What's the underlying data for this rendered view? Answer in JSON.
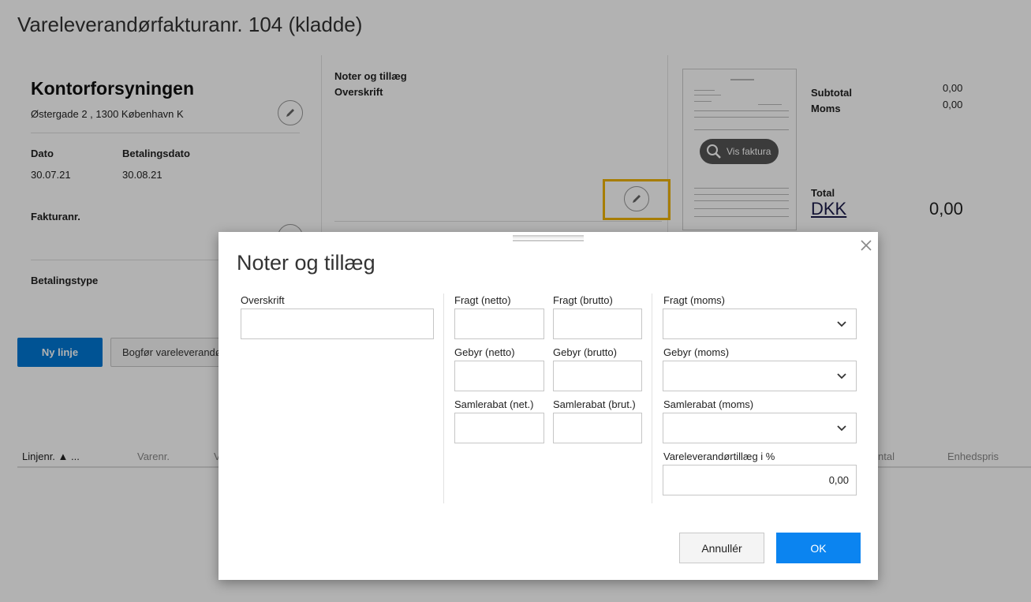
{
  "page": {
    "title": "Vareleverandørfakturanr. 104 (kladde)"
  },
  "supplier": {
    "name": "Kontorforsyningen",
    "address": "Østergade 2 , 1300 København K",
    "dato_label": "Dato",
    "dato_value": "30.07.21",
    "betalingsdato_label": "Betalingsdato",
    "betalingsdato_value": "30.08.21",
    "fakturanr_label": "Fakturanr.",
    "betalingstype_label": "Betalingstype"
  },
  "notes_panel": {
    "heading": "Noter og tillæg",
    "overskrift_label": "Overskrift"
  },
  "invoice_preview": {
    "vis_faktura_label": "Vis faktura"
  },
  "totals": {
    "subtotal_label": "Subtotal",
    "subtotal_value": "0,00",
    "moms_label": "Moms",
    "moms_value": "0,00",
    "total_label": "Total",
    "currency": "DKK",
    "total_value": "0,00"
  },
  "actions": {
    "ny_linje": "Ny linje",
    "bogfor": "Bogfør vareleverandørfaktura"
  },
  "table": {
    "columns": [
      "Linjenr. ▲ ...",
      "Varenr.",
      "V",
      "ntal",
      "Enhedspris"
    ]
  },
  "modal": {
    "title": "Noter og tillæg",
    "overskrift_label": "Overskrift",
    "overskrift_value": "",
    "fragt_netto_label": "Fragt (netto)",
    "fragt_brutto_label": "Fragt (brutto)",
    "fragt_moms_label": "Fragt (moms)",
    "gebyr_netto_label": "Gebyr (netto)",
    "gebyr_brutto_label": "Gebyr (brutto)",
    "gebyr_moms_label": "Gebyr (moms)",
    "samlerabat_net_label": "Samlerabat (net.)",
    "samlerabat_brut_label": "Samlerabat (brut.)",
    "samlerabat_moms_label": "Samlerabat (moms)",
    "tillaeg_label": "Vareleverandørtillæg i %",
    "tillaeg_value": "0,00",
    "cancel_label": "Annullér",
    "ok_label": "OK"
  },
  "colors": {
    "primary": "#0078d4",
    "ok_button": "#0b84f0",
    "highlight": "#f0b400"
  }
}
